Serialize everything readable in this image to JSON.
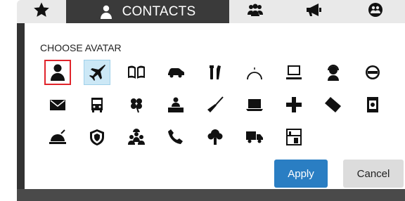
{
  "tabs": {
    "contacts_label": "CONTACTS"
  },
  "dialog": {
    "heading": "CHOOSE AVATAR",
    "apply_label": "Apply",
    "cancel_label": "Cancel"
  },
  "avatars": {
    "row1": [
      "person",
      "airplane",
      "book",
      "car",
      "tools",
      "gauge",
      "computer",
      "support-agent",
      "no-entry"
    ],
    "row2": [
      "mail",
      "bus",
      "flower",
      "desk-worker",
      "broom",
      "laptop",
      "cross",
      "ticket",
      "safe"
    ],
    "row3": [
      "hand-bell",
      "shield",
      "workers",
      "phone",
      "tree",
      "truck",
      "shelf"
    ],
    "selected": "person",
    "hovered": "airplane"
  },
  "colors": {
    "active_tab": "#3a3a3a",
    "inactive_tab": "#e9e9e9",
    "apply_button": "#2a7ec3",
    "selected_border": "#e0242b",
    "hover_bg": "#cce8f6"
  }
}
